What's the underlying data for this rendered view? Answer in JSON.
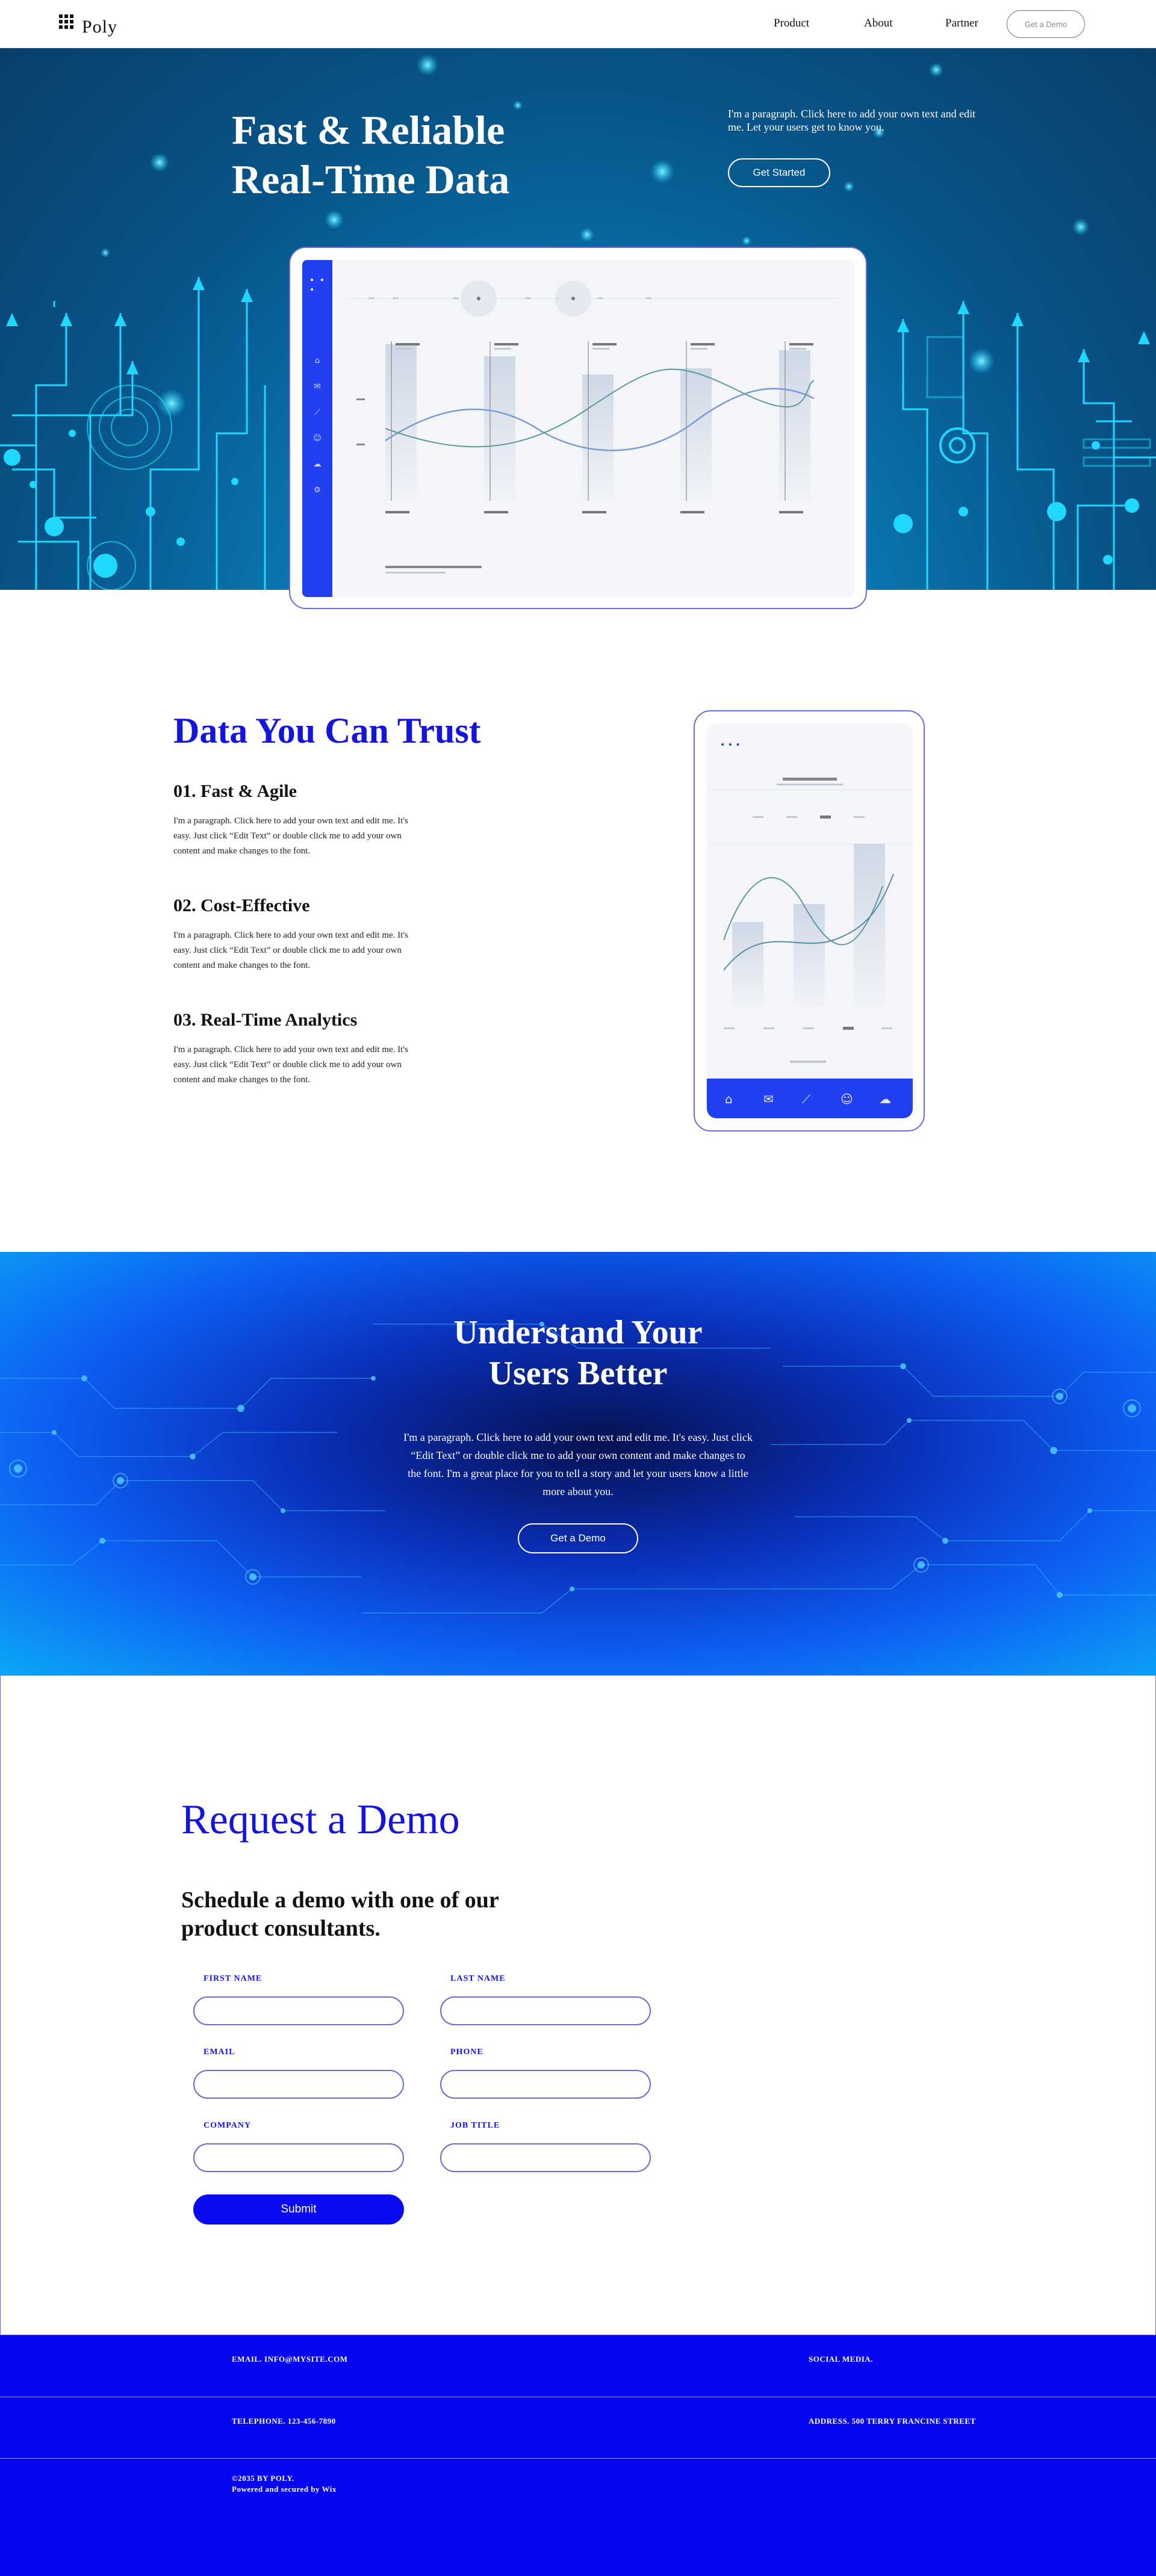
{
  "header": {
    "logo_text": "Poly",
    "nav": [
      "Product",
      "About",
      "Partner"
    ],
    "cta": "Get a Demo"
  },
  "hero": {
    "title_line1": "Fast & Reliable",
    "title_line2": "Real-Time Data",
    "paragraph": "I'm a paragraph. Click here to add your own text and edit me. Let your users get to know you.",
    "button": "Get Started"
  },
  "trust": {
    "title": "Data You Can Trust",
    "features": [
      {
        "heading": "01. Fast & Agile",
        "text": "I'm a paragraph. Click here to add your own text and edit me. It's easy. Just click “Edit Text” or double click me to add your own content and make changes to the font."
      },
      {
        "heading": "02. Cost-Effective",
        "text": "I'm a paragraph. Click here to add your own text and edit me. It's easy. Just click “Edit Text” or double click me to add your own content and make changes to the font."
      },
      {
        "heading": "03. Real-Time Analytics",
        "text": "I'm a paragraph. Click here to add your own text and edit me. It's easy. Just click “Edit Text” or double click me to add your own content and make changes to the font."
      }
    ]
  },
  "understand": {
    "title_line1": "Understand Your",
    "title_line2": "Users Better",
    "paragraph": "I'm a paragraph. Click here to add your own text and edit me. It's easy. Just click “Edit Text” or double click me to add your own content and make changes to the font. I'm a great place for you to tell a story and let your users know a little more about you.",
    "button": "Get a Demo"
  },
  "request": {
    "title": "Request a Demo",
    "subtitle": "Schedule a demo with one of our product consultants.",
    "fields": {
      "first_name": "FIRST NAME",
      "last_name": "LAST NAME",
      "email": "EMAIL",
      "phone": "PHONE",
      "company": "COMPANY",
      "job_title": "JOB TITLE"
    },
    "submit": "Submit"
  },
  "footer": {
    "email": "EMAIL. INFO@MYSITE.COM",
    "social": "SOCIAL MEDIA.",
    "telephone": "TELEPHONE. 123-456-7890",
    "address": "ADDRESS. 500 TERRY FRANCINE STREET",
    "copyright": "©2035 BY POLY.",
    "powered": "Powered and secured by Wix"
  },
  "colors": {
    "brand_blue": "#1414e0",
    "footer_blue": "#0505f0",
    "frame_purple": "#6b6bd8"
  }
}
